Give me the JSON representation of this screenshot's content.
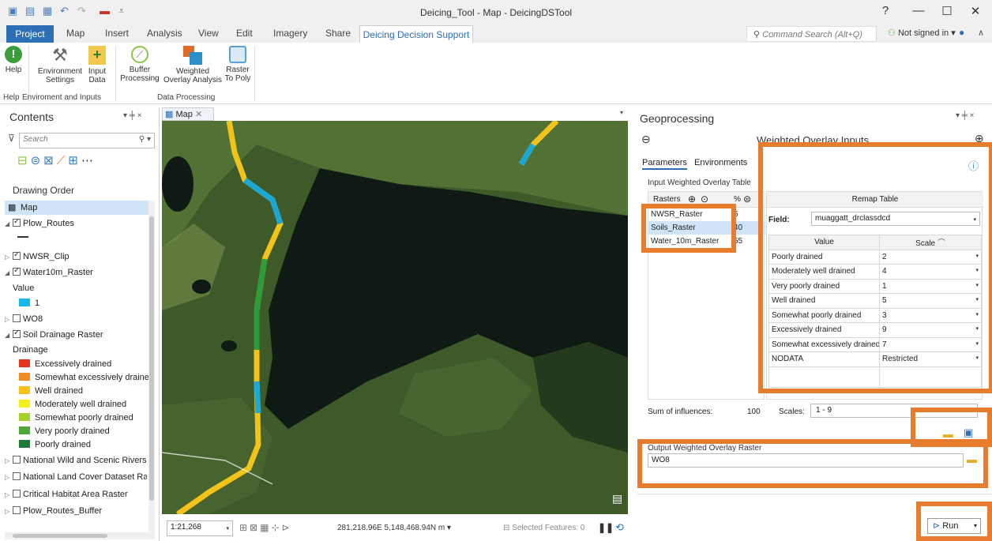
{
  "window": {
    "title": "Deicing_Tool - Map - DeicingDSTool",
    "help": "?",
    "minimize": "—",
    "maximize": "☐",
    "close": "✕"
  },
  "tabs": {
    "project": "Project",
    "items": [
      "Map",
      "Insert",
      "Analysis",
      "View",
      "Edit",
      "Imagery",
      "Share"
    ],
    "active": "Deicing Decision Support"
  },
  "command_search": {
    "placeholder": "Command Search (Alt+Q)"
  },
  "account": {
    "label": "Not signed in"
  },
  "ribbon": {
    "buttons": [
      {
        "label1": "Help",
        "label2": ""
      },
      {
        "label1": "Environment",
        "label2": "Settings"
      },
      {
        "label1": "Input",
        "label2": "Data"
      },
      {
        "label1": "Buffer",
        "label2": "Processing"
      },
      {
        "label1": "Weighted",
        "label2": "Overlay Analysis"
      },
      {
        "label1": "Raster",
        "label2": "To Poly"
      }
    ],
    "groups": [
      "Help",
      "Enviroment and Inputs",
      "Data Processing"
    ]
  },
  "contents": {
    "title": "Contents",
    "pin": "▾ ╪ ×",
    "search_placeholder": "Search",
    "drawing_order": "Drawing Order",
    "layers": {
      "map": "Map",
      "plow_routes": "Plow_Routes",
      "nwsr": "NWSR_Clip",
      "water": "Water10m_Raster",
      "value_hdr": "Value",
      "value_1": "1",
      "wo8": "WO8",
      "soil": "Soil Drainage Raster",
      "drainage_hdr": "Drainage",
      "legend": [
        {
          "label": "Excessively drained",
          "color": "#e8341c"
        },
        {
          "label": "Somewhat excessively drained",
          "color": "#f28b22"
        },
        {
          "label": "Well drained",
          "color": "#f7c21a"
        },
        {
          "label": "Moderately well drained",
          "color": "#f4ef1d"
        },
        {
          "label": "Somewhat poorly drained",
          "color": "#a5d12b"
        },
        {
          "label": "Very poorly drained",
          "color": "#4fa83a"
        },
        {
          "label": "Poorly drained",
          "color": "#1f7a34"
        }
      ],
      "national_wild": "National Wild and Scenic Rivers R",
      "national_land": "National Land Cover Dataset Rast",
      "critical": "Critical Habitat Area Raster",
      "plow_buffer": "Plow_Routes_Buffer"
    }
  },
  "map": {
    "tab": "Map",
    "scale": "1:21,268",
    "coords": "281,218.96E 5,148,468.94N m",
    "selected": "Selected Features: 0"
  },
  "geo": {
    "title": "Geoprocessing",
    "pin": "▾ ╪ ×",
    "tool_title": "Weighted Overlay Inputs",
    "tabs": [
      "Parameters",
      "Environments"
    ],
    "input_label": "Input Weighted Overlay Table",
    "rasters_hdr": "Rasters",
    "pct_hdr": "%",
    "rasters": [
      {
        "name": "NWSR_Raster",
        "pct": "5"
      },
      {
        "name": "Soils_Raster",
        "pct": "40"
      },
      {
        "name": "Water_10m_Raster",
        "pct": "55"
      }
    ],
    "remap_title": "Remap Table",
    "field_label": "Field:",
    "field_value": "muaggatt_drclassdcd",
    "value_hdr": "Value",
    "scale_hdr": "Scale",
    "remap": [
      {
        "value": "Poorly drained",
        "scale": "2"
      },
      {
        "value": "Moderately well drained",
        "scale": "4"
      },
      {
        "value": "Very poorly drained",
        "scale": "1"
      },
      {
        "value": "Well drained",
        "scale": "5"
      },
      {
        "value": "Somewhat poorly drained",
        "scale": "3"
      },
      {
        "value": "Excessively drained",
        "scale": "9"
      },
      {
        "value": "Somewhat excessively drained",
        "scale": "7"
      },
      {
        "value": "NODATA",
        "scale": "Restricted"
      }
    ],
    "sum_label": "Sum of influences:",
    "sum_value": "100",
    "scales_label": "Scales:",
    "scales_value": "1 - 9",
    "output_label": "Output Weighted Overlay Raster",
    "output_value": "WO8",
    "run": "Run"
  },
  "colors": {
    "accent": "#2c6fb7",
    "highlight": "#e77c2e"
  }
}
